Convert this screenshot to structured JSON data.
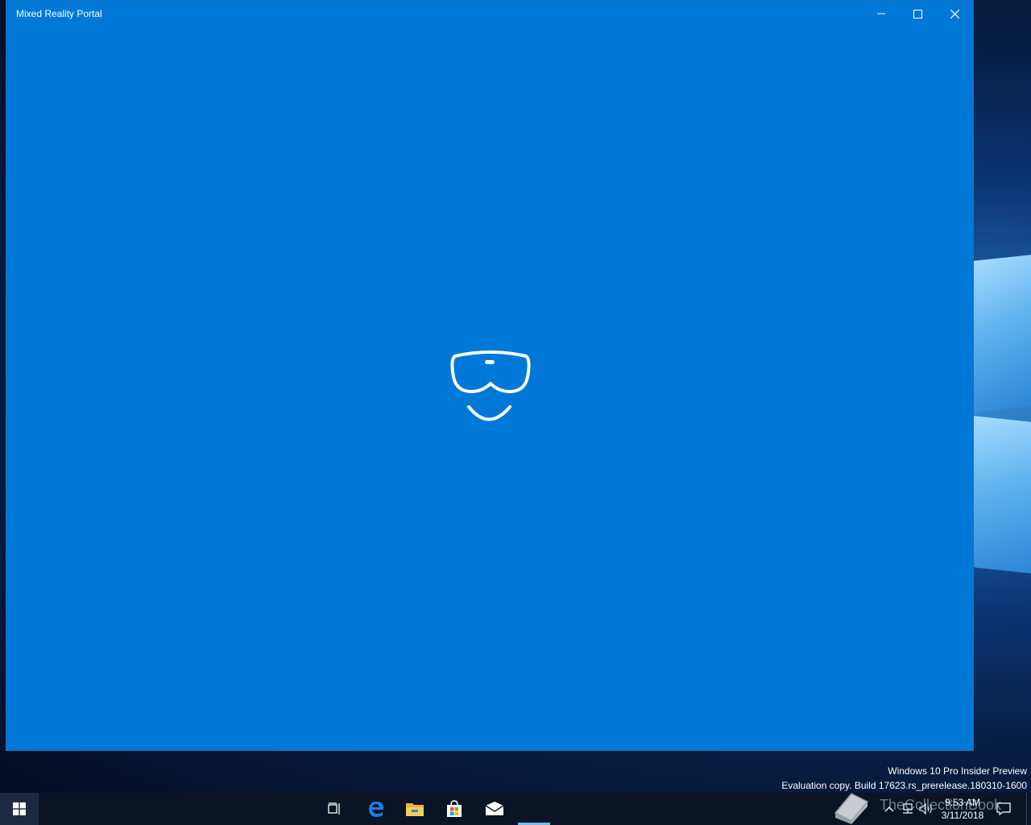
{
  "window": {
    "title": "Mixed Reality Portal",
    "background_color": "#0078d7",
    "buttons": {
      "minimize": "minimize-icon",
      "maximize": "maximize-icon",
      "close": "close-icon"
    },
    "center_icon": "mixed-reality-headset-icon"
  },
  "watermark": {
    "line1": "Windows 10 Pro Insider Preview",
    "line2": "Evaluation copy. Build 17623.rs_prerelease.180310-1600"
  },
  "taskbar": {
    "start_icon": "windows-start-icon",
    "pinned": [
      {
        "name": "task-view-icon"
      },
      {
        "name": "edge-icon"
      },
      {
        "name": "file-explorer-icon"
      },
      {
        "name": "store-icon"
      },
      {
        "name": "mail-icon"
      }
    ],
    "tray": [
      "book-logo-icon",
      "show-hidden-icons-chevron",
      "network-icon",
      "volume-icon"
    ],
    "clock": {
      "time": "9:53 AM",
      "date": "3/11/2018"
    },
    "notification_icon": "action-center-icon"
  },
  "overlay": {
    "text": "TheCollectionBook"
  }
}
